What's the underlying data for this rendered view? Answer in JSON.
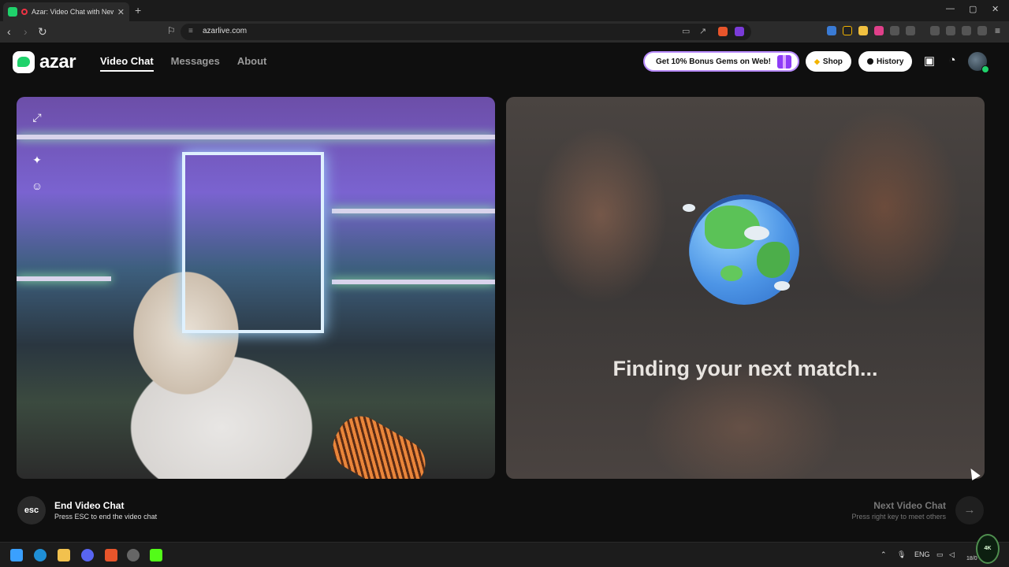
{
  "browser": {
    "tab_title": "Azar: Video Chat with New Pe",
    "tab_close": "✕",
    "new_tab": "+",
    "url": "azarlive.com",
    "window_controls": [
      "—",
      "▢",
      "✕"
    ]
  },
  "header": {
    "logo_text": "azar",
    "nav": [
      {
        "label": "Video Chat",
        "active": true
      },
      {
        "label": "Messages",
        "active": false
      },
      {
        "label": "About",
        "active": false
      }
    ],
    "promo_label": "Get 10% Bonus Gems on Web!",
    "shop_label": "Shop",
    "history_label": "History"
  },
  "match": {
    "status_text": "Finding your next match..."
  },
  "bottom": {
    "esc_key": "esc",
    "end_title": "End Video Chat",
    "end_hint": "Press ESC to end the video chat",
    "next_title": "Next Video Chat",
    "next_hint": "Press right key to meet others",
    "next_arrow": "→"
  },
  "taskbar": {
    "language": "ENG",
    "date": "18/0",
    "badge_text": "4K"
  },
  "colors": {
    "brand_green": "#1fd26b",
    "promo_purple": "#8e3cf7",
    "background": "#0f0f0f"
  }
}
